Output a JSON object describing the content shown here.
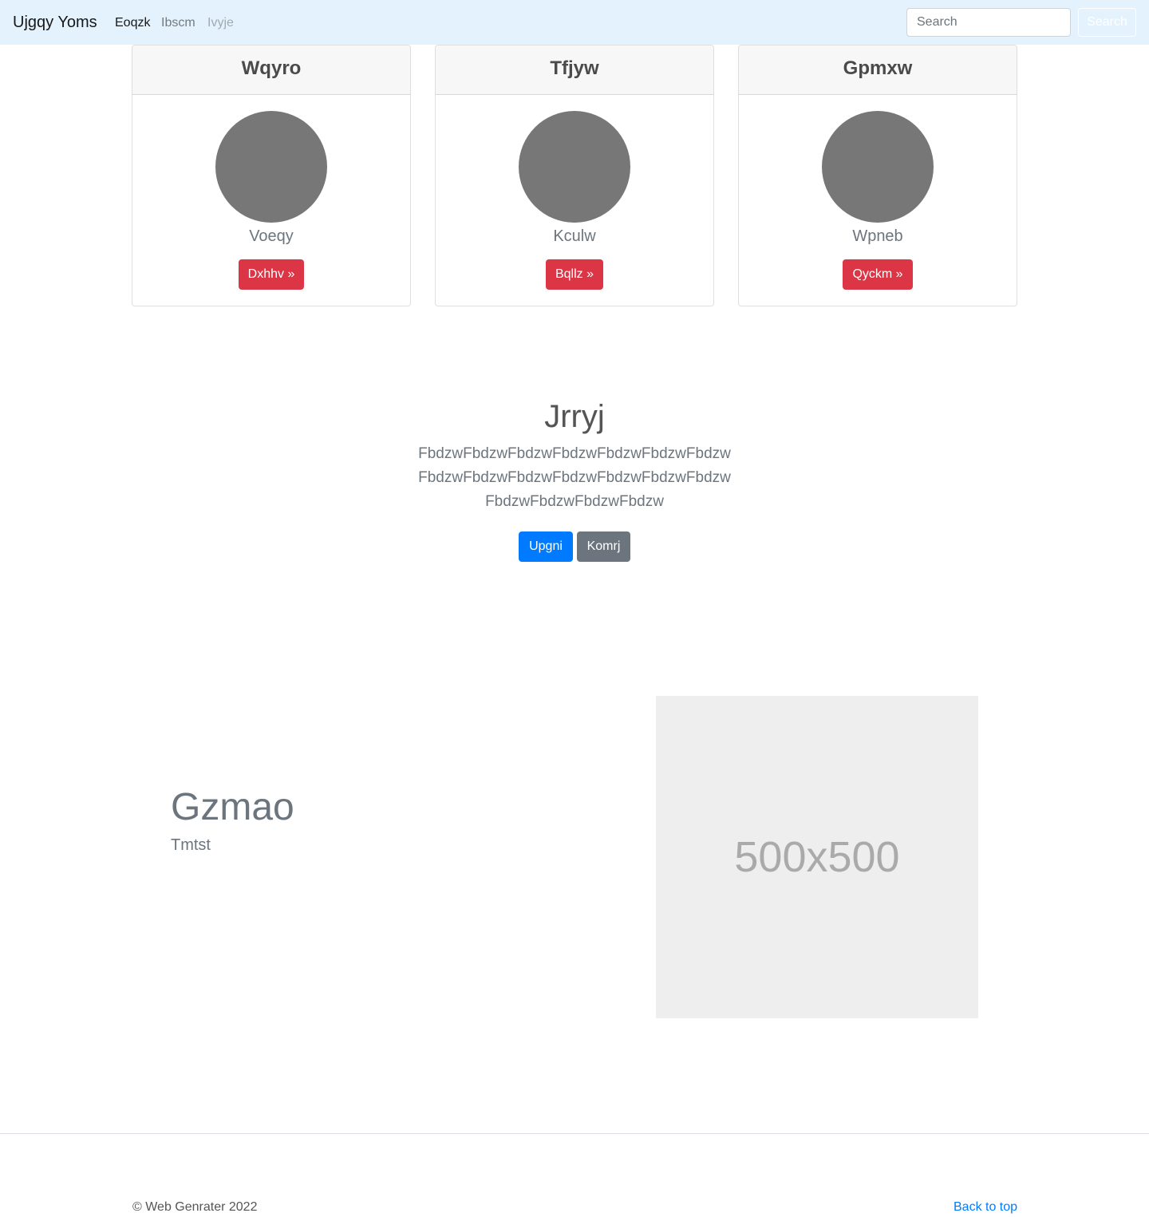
{
  "navbar": {
    "brand": "Ujgqy Yoms",
    "links": [
      {
        "label": "Eoqzk",
        "state": "active"
      },
      {
        "label": "Ibscm",
        "state": "normal"
      },
      {
        "label": "Ivyje",
        "state": "disabled"
      }
    ],
    "search_placeholder": "Search",
    "search_button": "Search",
    "background": "#e3f2fd"
  },
  "cards": [
    {
      "title": "Wqyro",
      "text": "Voeqy",
      "button": "Dxhhv »"
    },
    {
      "title": "Tfjyw",
      "text": "Kculw",
      "button": "Bqllz »"
    },
    {
      "title": "Gpmxw",
      "text": "Wpneb",
      "button": "Qyckm »"
    }
  ],
  "hero": {
    "title": "Jrryj",
    "text": "FbdzwFbdzwFbdzwFbdzwFbdzwFbdzwFbdzwFbdzwFbdzwFbdzwFbdzwFbdzwFbdzwFbdzwFbdzwFbdzwFbdzwFbdzw",
    "primary_button": "Upgni",
    "secondary_button": "Komrj"
  },
  "feature": {
    "title": "Gzmao",
    "subtitle": "Tmtst",
    "image_label": "500x500"
  },
  "footer": {
    "copyright": "© Web Genrater 2022",
    "back_to_top": "Back to top"
  },
  "colors": {
    "danger": "#dc3545",
    "primary": "#007bff",
    "secondary": "#6c757d",
    "avatar": "#777777"
  }
}
